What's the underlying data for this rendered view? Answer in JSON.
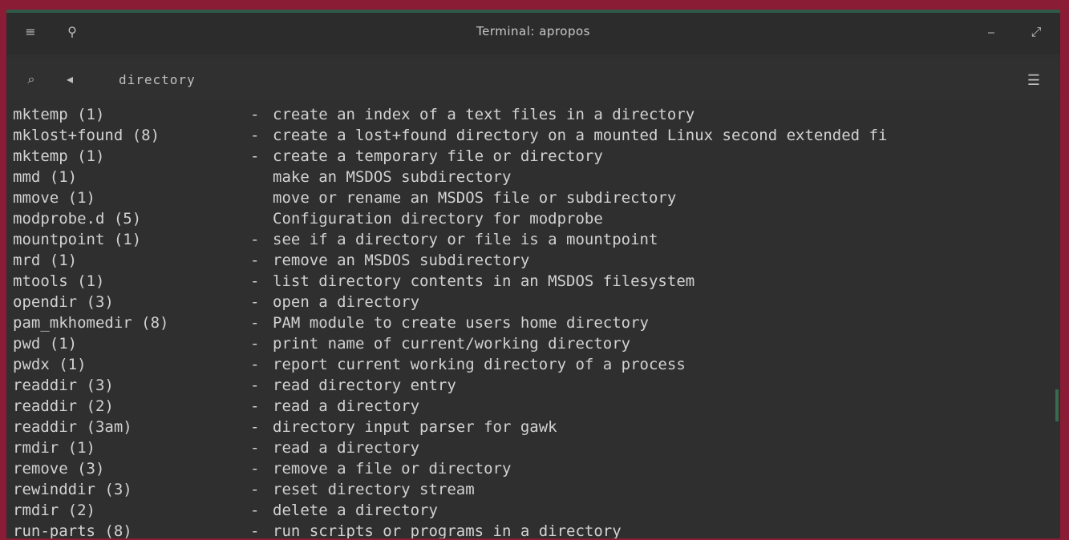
{
  "window": {
    "title": "Terminal: apropos",
    "titlebar_left_icon": "menu-icon",
    "titlebar_pin_icon": "pin-icon",
    "titlebar_right_icons": [
      "minimize-icon",
      "expand-icon"
    ]
  },
  "toolbar": {
    "search_label": "directory",
    "menu_icon": "hamburger-icon"
  },
  "lines": [
    {
      "name": "mktemp (1)",
      "sep": "-",
      "desc": "create an index of a text files in a directory"
    },
    {
      "name": "mklost+found (8)",
      "sep": "-",
      "desc": "create a lost+found directory on a mounted Linux second extended fi"
    },
    {
      "name": "mktemp (1)",
      "sep": "-",
      "desc": "create a temporary file or directory"
    },
    {
      "name": "mmd (1)",
      "sep": "",
      "desc": "make an MSDOS subdirectory"
    },
    {
      "name": "mmove (1)",
      "sep": "",
      "desc": "move or rename an MSDOS file or subdirectory"
    },
    {
      "name": "modprobe.d (5)",
      "sep": "",
      "desc": "Configuration directory for modprobe"
    },
    {
      "name": "mountpoint (1)",
      "sep": "-",
      "desc": "see if a directory or file is a mountpoint"
    },
    {
      "name": "mrd (1)",
      "sep": "-",
      "desc": "remove an MSDOS subdirectory"
    },
    {
      "name": "mtools (1)",
      "sep": "-",
      "desc": "list directory contents in an MSDOS filesystem"
    },
    {
      "name": "opendir (3)",
      "sep": "-",
      "desc": "open a directory"
    },
    {
      "name": "pam_mkhomedir (8)",
      "sep": "-",
      "desc": "PAM module to create users home directory"
    },
    {
      "name": "pwd (1)",
      "sep": "-",
      "desc": "print name of current/working directory"
    },
    {
      "name": "pwdx (1)",
      "sep": "-",
      "desc": "report current working directory of a process"
    },
    {
      "name": "readdir (3)",
      "sep": "-",
      "desc": "read directory entry"
    },
    {
      "name": "readdir (2)",
      "sep": "-",
      "desc": "read a directory"
    },
    {
      "name": "readdir (3am)",
      "sep": "-",
      "desc": "directory input parser for gawk"
    },
    {
      "name": "rmdir (1)",
      "sep": "-",
      "desc": "read a directory"
    },
    {
      "name": "remove (3)",
      "sep": "-",
      "desc": "remove a file or directory"
    },
    {
      "name": "rewinddir (3)",
      "sep": "-",
      "desc": "reset directory stream"
    },
    {
      "name": "rmdir (2)",
      "sep": "-",
      "desc": "delete a directory"
    },
    {
      "name": "run-parts (8)",
      "sep": "-",
      "desc": "run scripts or programs in a directory"
    }
  ]
}
